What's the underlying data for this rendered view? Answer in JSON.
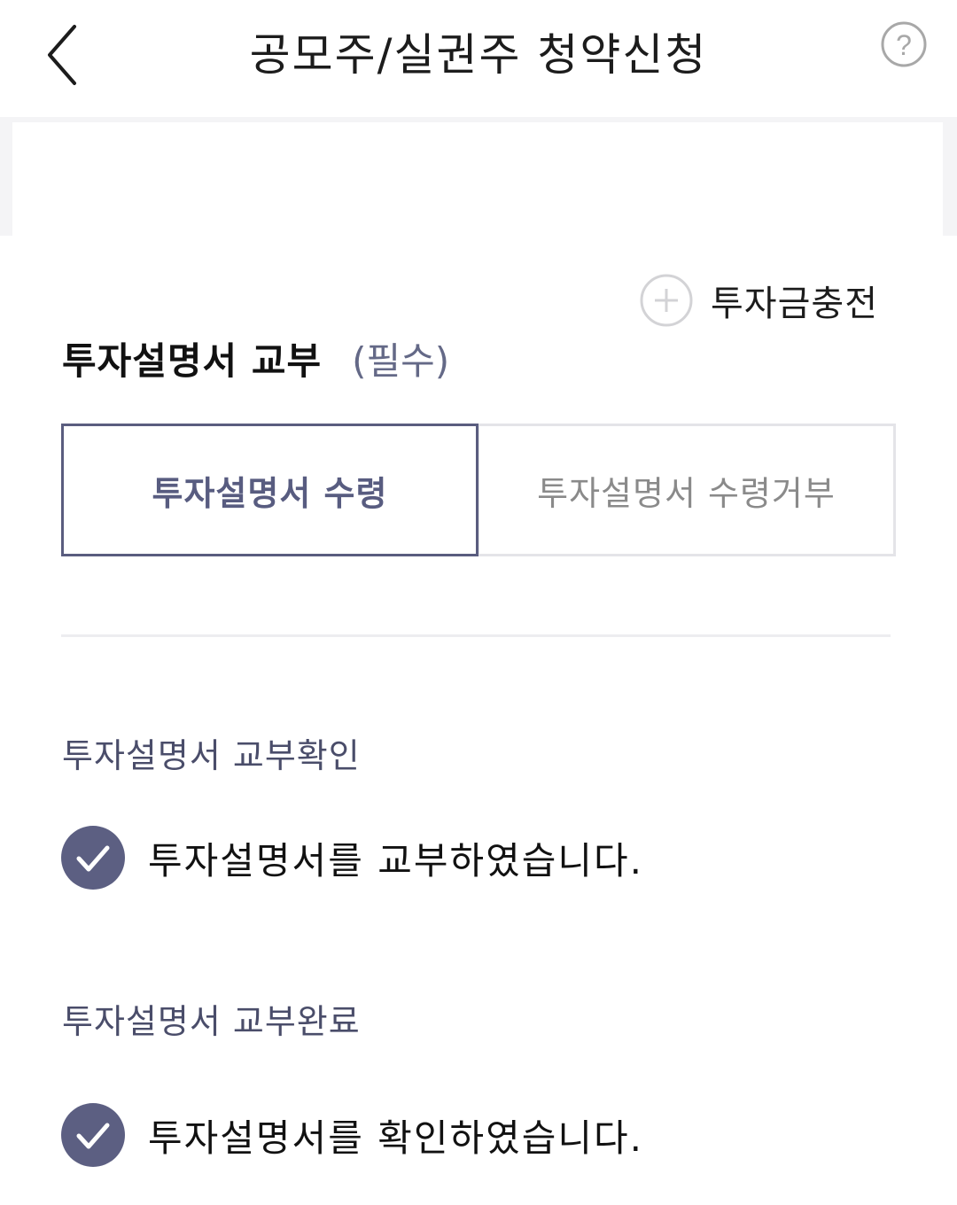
{
  "header": {
    "title": "공모주/실권주 청약신청"
  },
  "charge": {
    "label": "투자금충전"
  },
  "prospectus": {
    "title": "투자설명서 교부",
    "required": "(필수)",
    "options": [
      {
        "label": "투자설명서 수령",
        "selected": true
      },
      {
        "label": "투자설명서 수령거부",
        "selected": false
      }
    ]
  },
  "confirm": {
    "label": "투자설명서 교부확인",
    "check_text": "투자설명서를 교부하였습니다.",
    "checked": true
  },
  "complete": {
    "label": "투자설명서 교부완료",
    "check_text": "투자설명서를 확인하였습니다.",
    "checked": true
  },
  "colors": {
    "accent": "#5a5d7f",
    "check_fill": "#5c5f82",
    "border_inactive": "#e4e4e8",
    "band": "#f4f4f6"
  },
  "icons": {
    "back": "chevron-left-icon",
    "help": "question-circle-icon",
    "charge": "plus-circle-icon",
    "check": "check-circle-icon"
  }
}
